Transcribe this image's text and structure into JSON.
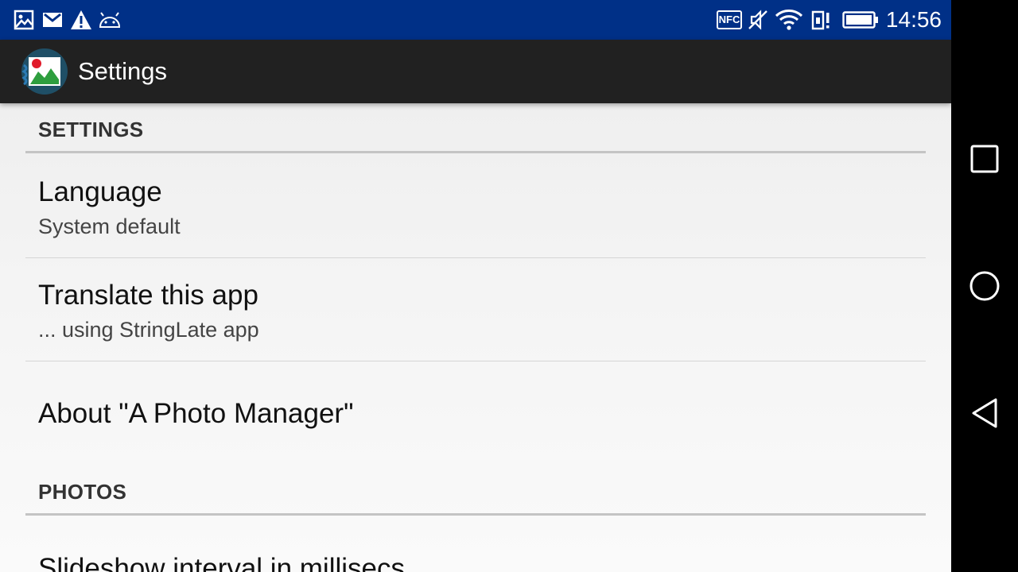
{
  "status_bar": {
    "time": "14:56",
    "background_color": "#003087",
    "left_icons": [
      "gallery-icon",
      "gmail-icon",
      "warning-icon",
      "android-debug-icon"
    ],
    "right_icons": [
      "nfc-icon",
      "vibrate-off-icon",
      "wifi-icon",
      "sim-alert-icon",
      "battery-icon"
    ],
    "nfc_label": "NFC"
  },
  "action_bar": {
    "title": "Settings",
    "background_color": "#212121"
  },
  "sections": [
    {
      "header": "SETTINGS",
      "items": [
        {
          "title": "Language",
          "summary": "System default"
        },
        {
          "title": "Translate this app",
          "summary": "... using StringLate app"
        },
        {
          "title": "About \"A Photo Manager\""
        }
      ]
    },
    {
      "header": "PHOTOS",
      "items": [
        {
          "title": "Slideshow interval in millisecs"
        }
      ]
    }
  ],
  "nav_bar": {
    "buttons": [
      "recents-button",
      "home-button",
      "back-button"
    ]
  }
}
